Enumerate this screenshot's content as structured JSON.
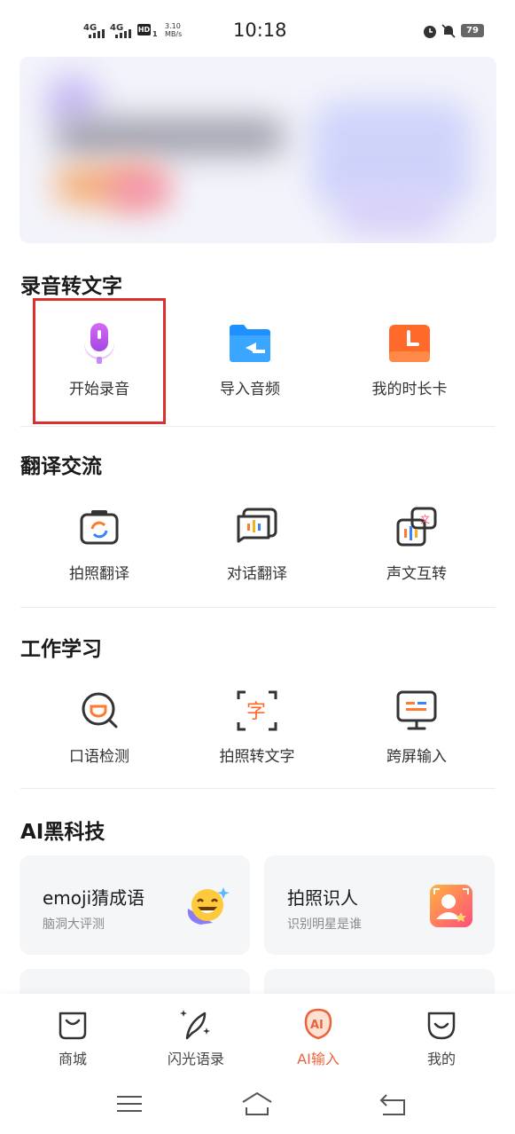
{
  "status_bar": {
    "signal1": "4G",
    "signal2": "4G",
    "hd": "HD",
    "hd_sub": "1",
    "speed_value": "3.10",
    "speed_unit": "MB/s",
    "time": "10:18",
    "battery": "79"
  },
  "sections": {
    "record": {
      "title": "录音转文字",
      "items": [
        {
          "label": "开始录音",
          "icon": "microphone-icon"
        },
        {
          "label": "导入音频",
          "icon": "folder-icon"
        },
        {
          "label": "我的时长卡",
          "icon": "clock-icon"
        }
      ]
    },
    "translate": {
      "title": "翻译交流",
      "items": [
        {
          "label": "拍照翻译",
          "icon": "camera-translate-icon"
        },
        {
          "label": "对话翻译",
          "icon": "dialog-translate-icon"
        },
        {
          "label": "声文互转",
          "icon": "voice-text-convert-icon"
        }
      ]
    },
    "work": {
      "title": "工作学习",
      "items": [
        {
          "label": "口语检测",
          "icon": "speech-check-icon"
        },
        {
          "label": "拍照转文字",
          "icon": "photo-to-text-icon"
        },
        {
          "label": "跨屏输入",
          "icon": "cross-screen-input-icon"
        }
      ]
    },
    "ai": {
      "title": "AI黑科技",
      "cards": [
        {
          "title": "emoji猜成语",
          "subtitle": "脑洞大评测",
          "icon": "laughing-emoji-icon"
        },
        {
          "title": "拍照识人",
          "subtitle": "识别明星是谁",
          "icon": "face-recognition-icon"
        }
      ]
    }
  },
  "tabbar": {
    "items": [
      {
        "label": "商城",
        "icon": "shop-bag-icon"
      },
      {
        "label": "闪光语录",
        "icon": "feather-sparkle-icon"
      },
      {
        "label": "AI输入",
        "icon": "ai-input-icon",
        "active": true
      },
      {
        "label": "我的",
        "icon": "smile-face-icon"
      }
    ]
  },
  "colors": {
    "accent": "#e8643c",
    "highlight_border": "#d9302c",
    "mic_purple": "#b84fe8",
    "folder_blue": "#1e90ff",
    "clock_orange": "#ff6a2a"
  }
}
